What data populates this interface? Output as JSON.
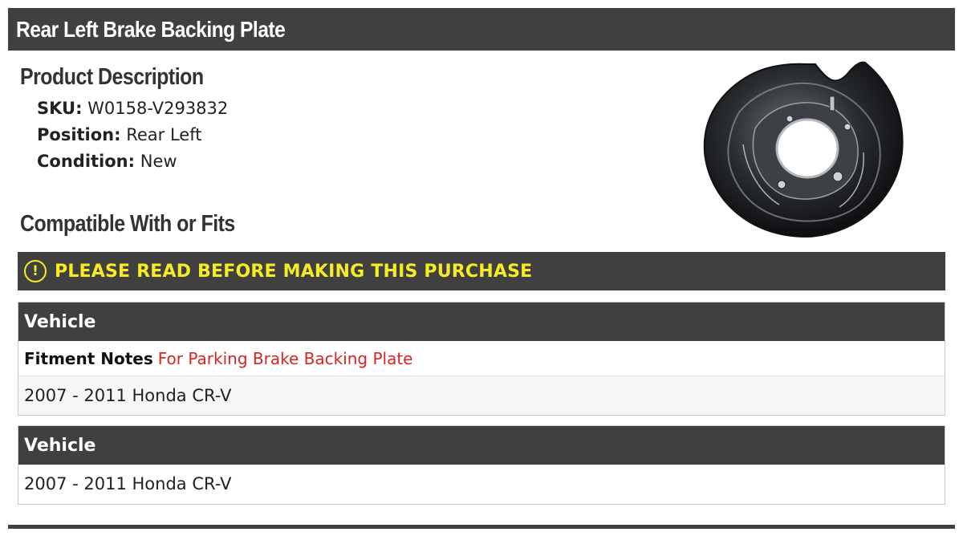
{
  "header": {
    "title": "Rear Left Brake Backing Plate"
  },
  "description": {
    "heading": "Product Description",
    "specs": [
      {
        "label": "SKU:",
        "value": "W0158-V293832"
      },
      {
        "label": "Position:",
        "value": "Rear Left"
      },
      {
        "label": "Condition:",
        "value": "New"
      }
    ]
  },
  "compatibility": {
    "heading": "Compatible With or Fits",
    "warning": {
      "icon": "exclamation-circle-icon",
      "text": "PLEASE READ BEFORE MAKING THIS PURCHASE",
      "color": "#f6ec23"
    },
    "tables": [
      {
        "header": "Vehicle",
        "notes_label": "Fitment Notes",
        "notes_value": "For Parking Brake Backing Plate",
        "rows": [
          "2007 - 2011 Honda CR-V"
        ]
      },
      {
        "header": "Vehicle",
        "rows": [
          "2007 - 2011 Honda CR-V"
        ]
      }
    ]
  },
  "colors": {
    "bar": "#404040",
    "notes_accent": "#d72424"
  }
}
